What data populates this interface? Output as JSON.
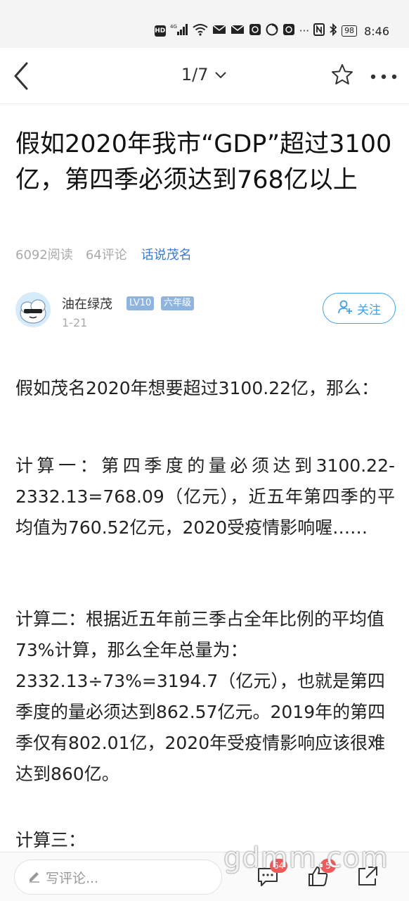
{
  "status": {
    "network_label": "HD",
    "cell_label": "4G",
    "battery": "98",
    "time": "8:46",
    "more": "···",
    "icons": [
      "hd-icon",
      "signal-icon",
      "wifi-icon",
      "mail-icon",
      "mail-icon",
      "app-icon",
      "app-icon",
      "app-icon",
      "nfc-icon",
      "bluetooth-icon",
      "battery-icon"
    ]
  },
  "nav": {
    "counter": "1/7",
    "icons": [
      "back-arrow-icon",
      "chevron-down-icon",
      "star-icon",
      "more-icon"
    ]
  },
  "article": {
    "title": "假如2020年我市“GDP”超过3100亿，第四季必须达到768亿以上",
    "reads": "6092阅读",
    "comments": "64评论",
    "topic": "话说茂名",
    "author": {
      "name": "油在绿茂",
      "level": "LV10",
      "grade": "六年级",
      "date": "1-21"
    },
    "follow_label": "关注",
    "paragraphs": [
      "假如茂名2020年想要超过3100.22亿，那么：",
      "计算一：第四季度的量必须达到3100.22-2332.13=768.09（亿元），近五年第四季的平均值为760.52亿元，2020受疫情影响喔……",
      "计算二：根据近五年前三季占全年比例的平均值73%计算，那么全年总量为：2332.13÷73%=3194.7（亿元），也就是第四季度的量必须达到862.57亿元。2019年的第四季仅有802.01亿，2020年受疫情影响应该很难达到860亿。",
      "计算三："
    ]
  },
  "bottom": {
    "comment_placeholder": "写评论...",
    "comment_count": "64",
    "like_count": "5",
    "watermark": "gdmm.com"
  },
  "colors": {
    "accent": "#3fa2e8",
    "topic": "#3c7cc8",
    "badge": "#8fb5de",
    "notify": "#f05a5a"
  }
}
